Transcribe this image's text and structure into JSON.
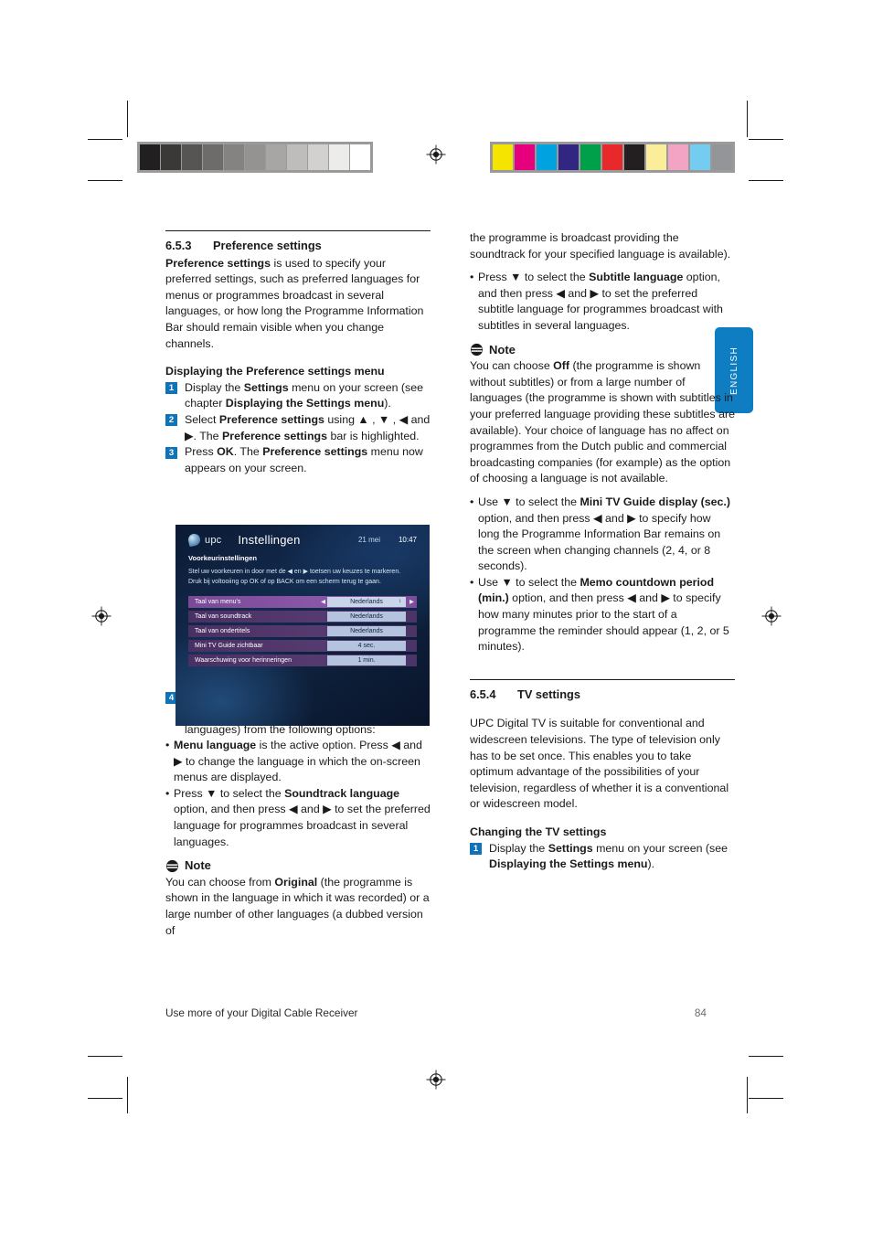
{
  "page": {
    "footer_left": "Use more of your Digital Cable Receiver",
    "page_number": "84",
    "lang_tab": "ENGLISH",
    "accent_blue": "#1072b8",
    "tab_blue": "#0f7dc2"
  },
  "calibration": {
    "gray_bar": [
      "#211f1f",
      "#3b3938",
      "#575554",
      "#6e6c6b",
      "#848382",
      "#949392",
      "#a7a6a5",
      "#bebdbc",
      "#d2d1d0",
      "#ececeb",
      "#ffffff"
    ],
    "color_bar": [
      "#f5e400",
      "#e6007e",
      "#00a3e0",
      "#312783",
      "#00a04a",
      "#e8292b",
      "#231f20",
      "#faee9b",
      "#f3a3c3",
      "#74cdf0",
      "#939598"
    ]
  },
  "left_column": {
    "section": {
      "number": "6.5.3",
      "title": "Preference settings"
    },
    "intro_lead": "Preference settings",
    "intro_rest": " is used to specify your preferred settings, such as preferred languages for menus or programmes broadcast in several languages, or how long the Programme Information Bar should remain visible when you change channels.",
    "subhead": "Displaying the Preference settings menu",
    "steps": [
      {
        "num": "1",
        "parts": [
          "Display the ",
          "Settings",
          " menu on your screen (see chapter ",
          "Displaying the Settings menu",
          ")."
        ]
      },
      {
        "num": "2",
        "parts": [
          "Select ",
          "Preference settings",
          " using ▲ , ▼ , ◀ and ▶. The ",
          "Preference settings",
          " bar is highlighted."
        ]
      },
      {
        "num": "3",
        "parts": [
          "Press ",
          "OK",
          ". The ",
          "Preference settings",
          " menu now appears on your screen."
        ]
      }
    ],
    "step4": {
      "num": "4",
      "text": "Choose your language preferences (only possible if the channel is broadcast in several languages) from the following options:"
    },
    "bullets": [
      {
        "parts": [
          "",
          "Menu language",
          " is the active option. Press ◀ and ▶ to change the language in which the on-screen menus are displayed."
        ]
      },
      {
        "parts": [
          "Press ▼ to select the ",
          "Soundtrack language",
          " option, and then press ◀ and ▶ to set the preferred language for programmes broadcast in several languages."
        ]
      }
    ],
    "note": {
      "label": "Note",
      "parts": [
        "You can choose from ",
        "Original",
        " (the programme is shown in the language in which it was recorded) or a large number of other languages (a dubbed version of"
      ]
    }
  },
  "right_column": {
    "continuation": "the programme is broadcast providing the soundtrack for your specified language is available).",
    "bullet_subtitle": {
      "parts": [
        "Press ▼ to select the ",
        "Subtitle language",
        " option, and then press ◀ and ▶ to set the preferred subtitle language for programmes broadcast with subtitles in several languages."
      ]
    },
    "note": {
      "label": "Note",
      "parts": [
        "You can choose ",
        "Off",
        " (the programme is shown without subtitles) or from a large number of languages (the programme is shown with subtitles in your preferred language providing these subtitles are available). Your choice of language has no affect on programmes from the Dutch public and commercial broadcasting companies (for example) as the option of choosing a language is not available."
      ]
    },
    "bullets": [
      {
        "parts": [
          "Use ▼ to select the ",
          "Mini TV Guide display (sec.)",
          " option, and then press ◀ and ▶ to specify how long the Programme Information Bar remains on the screen when changing channels (2, 4, or 8 seconds)."
        ]
      },
      {
        "parts": [
          "Use ▼ to select the ",
          "Memo countdown period (min.)",
          " option, and then press ◀ and ▶ to specify how many minutes prior to the start of a programme the reminder should appear (1, 2, or 5 minutes)."
        ]
      }
    ],
    "section": {
      "number": "6.5.4",
      "title": "TV settings"
    },
    "tv_intro": "UPC Digital TV is suitable for conventional and widescreen televisions. The type of television only has to be set once. This enables you to take optimum advantage of the possibilities of your television, regardless of whether it is a conventional or widescreen model.",
    "subhead": "Changing the TV settings",
    "step1": {
      "num": "1",
      "parts": [
        "Display the ",
        "Settings",
        " menu on your screen (see ",
        "Displaying the Settings menu",
        ")."
      ]
    }
  },
  "tv_screenshot": {
    "brand": "upc",
    "title": "Instellingen",
    "date": "21 mei",
    "time": "10:47",
    "subtitle": "Voorkeurinstellingen",
    "instruction": "Stel uw voorkeuren in door met de ◀ en ▶ toetsen uw keuzes te markeren. Druk bij voltooiing op OK of op BACK om een scherm terug te gaan.",
    "rows": [
      {
        "label": "Taal van menu's",
        "value": "Nederlands",
        "active": true
      },
      {
        "label": "Taal van soundtrack",
        "value": "Nederlands",
        "active": false
      },
      {
        "label": "Taal van ondertitels",
        "value": "Nederlands",
        "active": false
      },
      {
        "label": "Mini TV Guide zichtbaar",
        "value": "4 sec.",
        "active": false
      },
      {
        "label": "Waarschuwing voor herinneringen",
        "value": "1 min.",
        "active": false
      }
    ]
  }
}
